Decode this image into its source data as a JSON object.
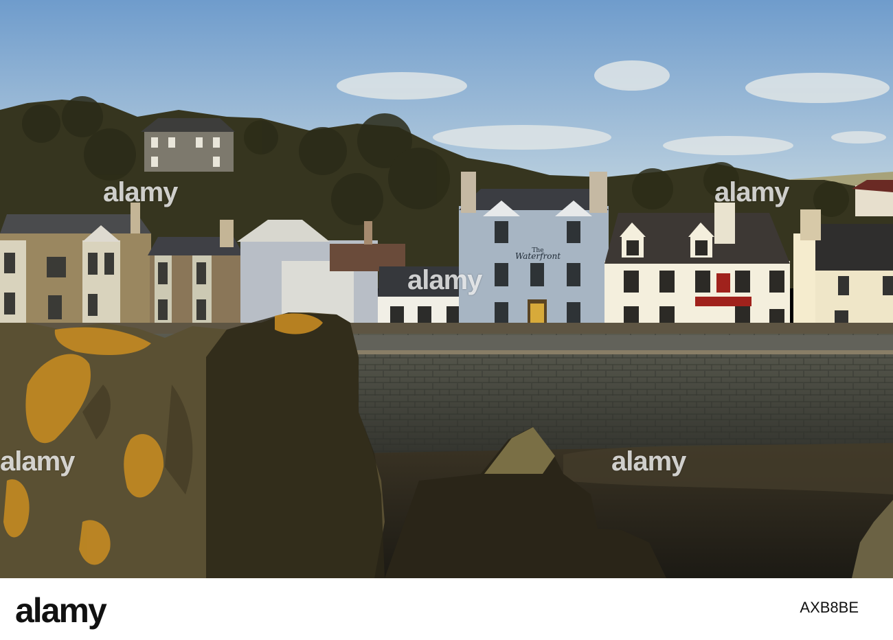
{
  "photo": {
    "sign_main": "The",
    "sign_name": "Waterfront",
    "palette": {
      "sky_top": "#7aa3cf",
      "sky_bottom": "#bdd1e1",
      "hill": "#3a3a1f",
      "wall": "#4a4c44",
      "lichen": "#c9901f",
      "water": "#27251b"
    }
  },
  "watermark": {
    "text": "alamy"
  },
  "footer": {
    "logo": "alamy",
    "image_id": "AXB8BE"
  }
}
